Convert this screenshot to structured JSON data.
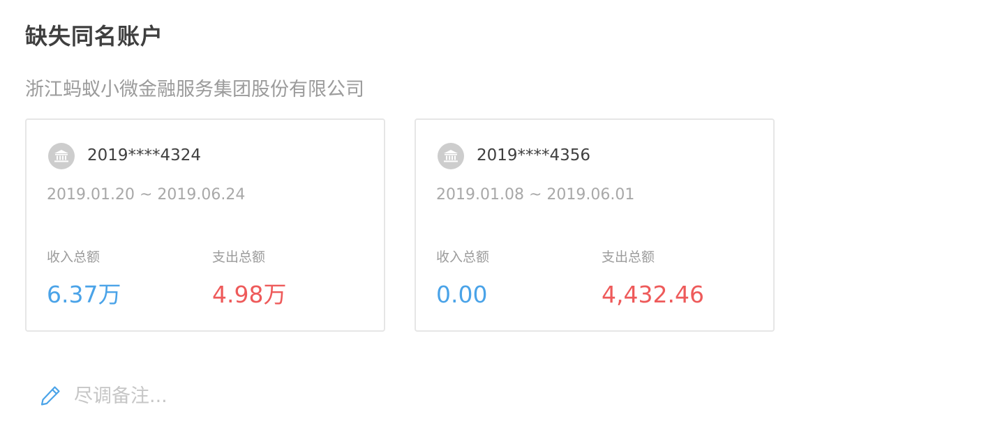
{
  "page": {
    "title": "缺失同名账户",
    "company": "浙江蚂蚁小微金融服务集团股份有限公司"
  },
  "colors": {
    "income": "#4aa3e8",
    "expense": "#ee5a5a",
    "bank_icon_bg": "#cdcdcd",
    "pencil": "#4aa3e8"
  },
  "accounts": [
    {
      "icon": "bank-icon",
      "number": "2019****4324",
      "date_range": "2019.01.20 ~ 2019.06.24",
      "income_label": "收入总额",
      "income_value": "6.37万",
      "expense_label": "支出总额",
      "expense_value": "4.98万"
    },
    {
      "icon": "bank-icon",
      "number": "2019****4356",
      "date_range": "2019.01.08 ~ 2019.06.01",
      "income_label": "收入总额",
      "income_value": "0.00",
      "expense_label": "支出总额",
      "expense_value": "4,432.46"
    }
  ],
  "note": {
    "icon": "pencil-icon",
    "value": "",
    "placeholder": "尽调备注..."
  }
}
